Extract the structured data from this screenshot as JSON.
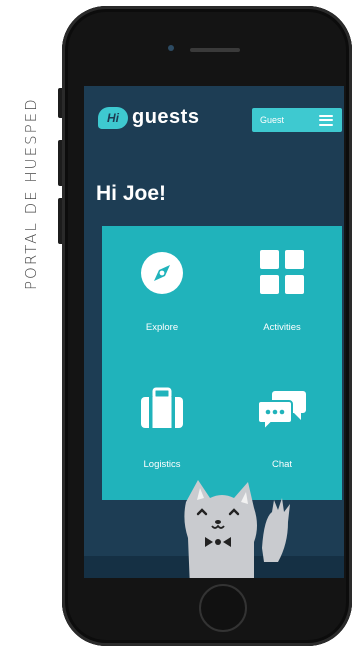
{
  "caption": "PORTAL DE HUESPED",
  "app": {
    "logo_badge": "Hi",
    "logo_text": "guests",
    "guest_button_label": "Guest",
    "greeting": "Hi Joe!"
  },
  "tiles": [
    {
      "label": "Explore",
      "icon": "compass-icon"
    },
    {
      "label": "Activities",
      "icon": "grid-icon"
    },
    {
      "label": "Logistics",
      "icon": "suitcase-icon"
    },
    {
      "label": "Chat",
      "icon": "chat-bubbles-icon"
    }
  ],
  "colors": {
    "screen_bg": "#1d3d54",
    "accent": "#3ec9d0",
    "tile_bg": "#20b3bb",
    "phone_body": "#141414"
  }
}
